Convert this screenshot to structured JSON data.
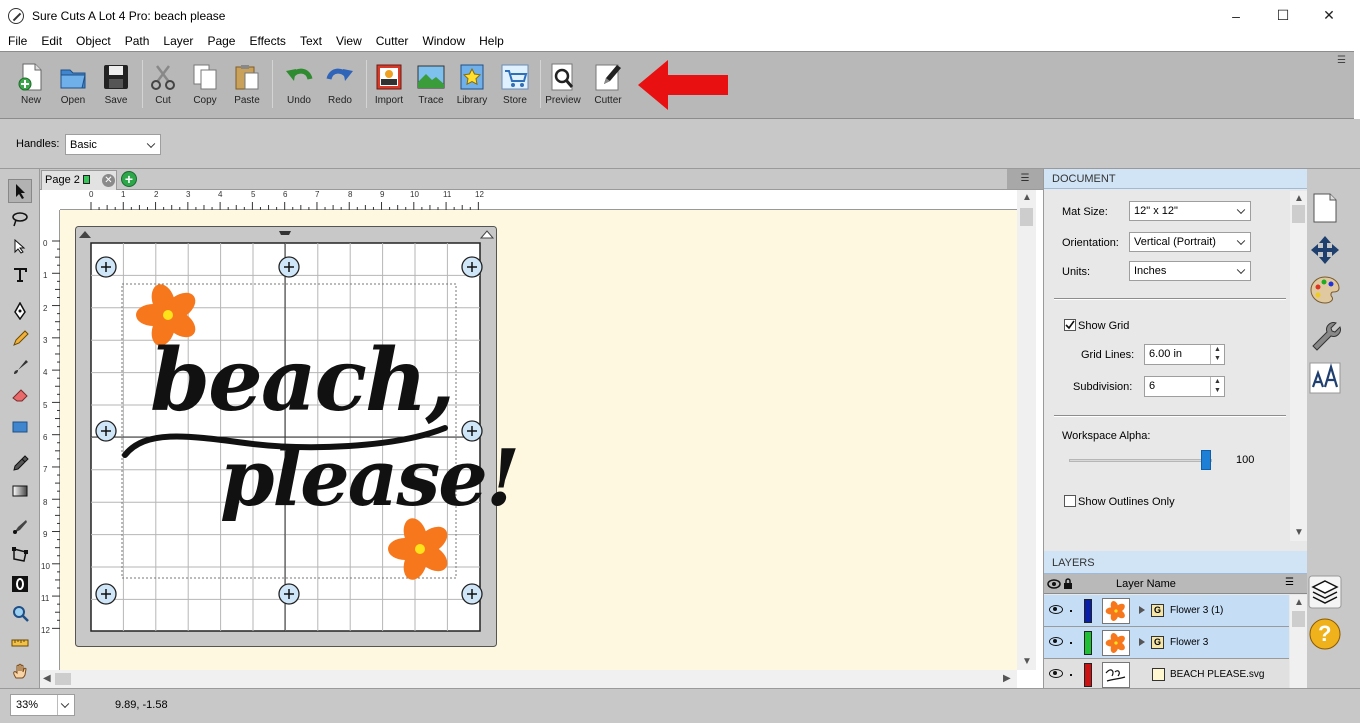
{
  "window": {
    "title": "Sure Cuts A Lot 4 Pro: beach please",
    "minimize": "–",
    "maximize": "☐",
    "close": "✕"
  },
  "menu": [
    "File",
    "Edit",
    "Object",
    "Path",
    "Layer",
    "Page",
    "Effects",
    "Text",
    "View",
    "Cutter",
    "Window",
    "Help"
  ],
  "toolbar": {
    "new": "New",
    "open": "Open",
    "save": "Save",
    "cut": "Cut",
    "copy": "Copy",
    "paste": "Paste",
    "undo": "Undo",
    "redo": "Redo",
    "import": "Import",
    "trace": "Trace",
    "library": "Library",
    "store": "Store",
    "preview": "Preview",
    "cutter": "Cutter",
    "menu_glyph": "☰"
  },
  "options": {
    "handles_label": "Handles:",
    "handles_value": "Basic"
  },
  "page_tab": {
    "label": "Page 2",
    "close": "✕",
    "add": "+"
  },
  "ruler": {
    "h_ticks": [
      "0",
      "1",
      "2",
      "3",
      "4",
      "5",
      "6",
      "7",
      "8",
      "9",
      "10",
      "11",
      "12"
    ],
    "v_ticks": [
      "0",
      "1",
      "2",
      "3",
      "4",
      "5",
      "6",
      "7",
      "8",
      "9",
      "10",
      "11",
      "12"
    ]
  },
  "artwork": {
    "line1": "beach,",
    "line2": "please!",
    "flower_color": "#f7771d",
    "flower_center": "#ffe21a"
  },
  "status": {
    "zoom": "33%",
    "coords": "9.89, -1.58"
  },
  "document_panel": {
    "title": "DOCUMENT",
    "mat_size_label": "Mat Size:",
    "mat_size_value": "12\" x 12\"",
    "orientation_label": "Orientation:",
    "orientation_value": "Vertical (Portrait)",
    "units_label": "Units:",
    "units_value": "Inches",
    "show_grid_label": "Show Grid",
    "show_grid_checked": true,
    "grid_lines_label": "Grid Lines:",
    "grid_lines_value": "6.00 in",
    "subdivision_label": "Subdivision:",
    "subdivision_value": "6",
    "workspace_alpha_label": "Workspace Alpha:",
    "workspace_alpha_value": "100",
    "workspace_alpha_fraction": 0.96,
    "show_outlines_label": "Show Outlines Only",
    "show_outlines_checked": false
  },
  "layers_panel": {
    "title": "LAYERS",
    "column_header": "Layer Name",
    "menu_glyph": "☰",
    "layers": [
      {
        "name": "Flower 3 (1)",
        "color": "#0a1fa8",
        "selected": true
      },
      {
        "name": "Flower 3",
        "color": "#1fbf35",
        "selected": true
      },
      {
        "name": "BEACH PLEASE.svg",
        "color": "#cc1313",
        "selected": false
      }
    ]
  },
  "dock": {
    "help": "?"
  },
  "colors": {
    "accent_arrow": "#e81010",
    "selection_blue": "#c6ddf6"
  }
}
